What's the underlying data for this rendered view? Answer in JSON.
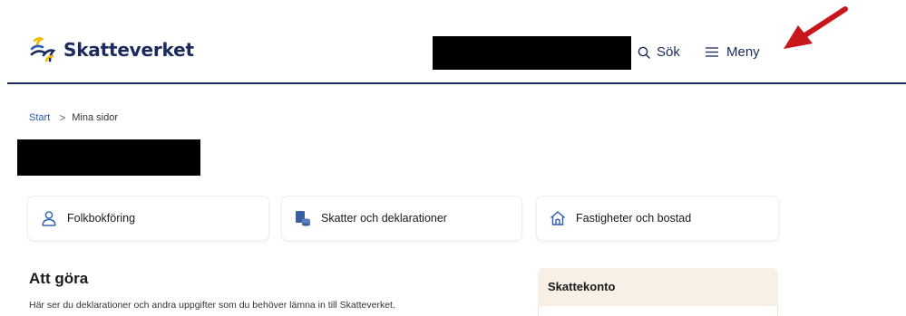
{
  "header": {
    "brand": "Skatteverket",
    "search_label": "Sök",
    "menu_label": "Meny"
  },
  "breadcrumb": {
    "items": [
      "Start",
      "Mina sidor"
    ],
    "separator": ">"
  },
  "shortcuts": [
    {
      "label": "Folkbokföring",
      "icon": "person-icon"
    },
    {
      "label": "Skatter och deklarationer",
      "icon": "document-stack-icon"
    },
    {
      "label": "Fastigheter och bostad",
      "icon": "house-icon"
    }
  ],
  "todo": {
    "title": "Att göra",
    "description": "Här ser du deklarationer och andra uppgifter som du behöver lämna in till Skatteverket."
  },
  "skattekonto": {
    "title": "Skattekonto"
  },
  "colors": {
    "brand_navy": "#1b2a5c",
    "link_blue": "#2a5db0",
    "logo_yellow": "#f5b800",
    "annotation_red": "#c8161d",
    "panel_beige": "#f8efe6"
  }
}
